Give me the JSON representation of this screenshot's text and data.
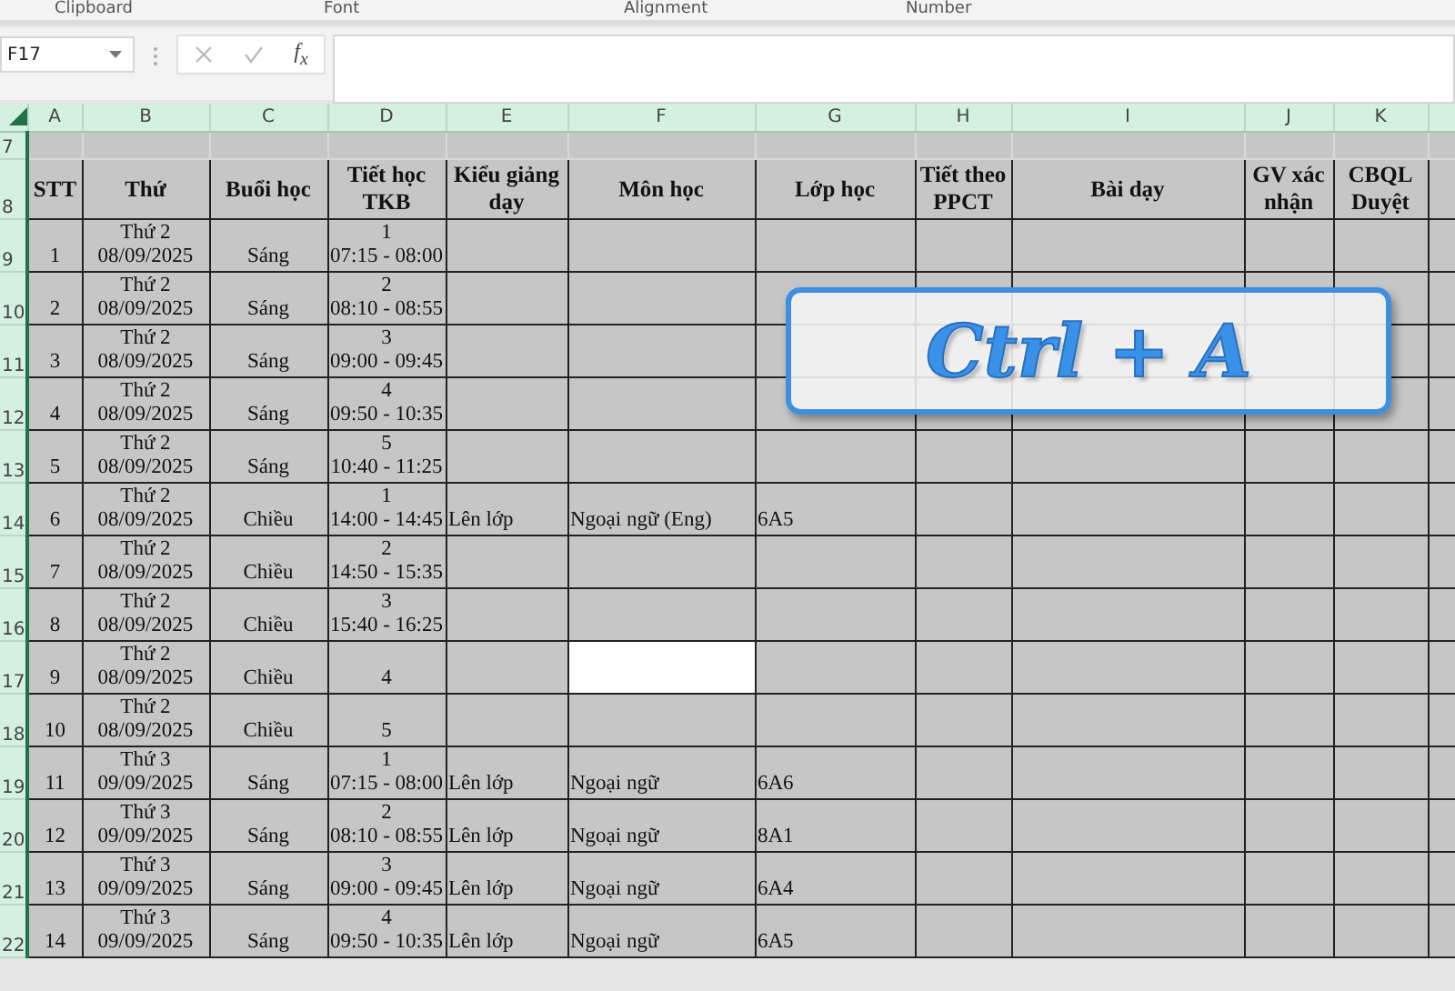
{
  "ribbon_groups": [
    "Clipboard",
    "Font",
    "Alignment",
    "Number"
  ],
  "formula_bar": {
    "name_box": "F17",
    "function_label": "f$_{x}$"
  },
  "columns": [
    "A",
    "B",
    "C",
    "D",
    "E",
    "F",
    "G",
    "H",
    "I",
    "J",
    "K"
  ],
  "blank_row": "7",
  "header_row": {
    "row": "8",
    "cells": [
      "STT",
      "Thứ",
      "Buổi học",
      "Tiết học TKB",
      "Kiểu giảng dạy",
      "Môn học",
      "Lớp học",
      "Tiết theo PPCT",
      "Bài dạy",
      "GV xác nhận",
      "CBQL Duyệt"
    ]
  },
  "rows": [
    {
      "row": "9",
      "stt": "1",
      "thu": "Thứ 2",
      "date": "08/09/2025",
      "buoi": "Sáng",
      "tiet": "1",
      "time": "07:15 - 08:00",
      "mon_hoc": {
        "selected": false
      }
    },
    {
      "row": "10",
      "stt": "2",
      "thu": "Thứ 2",
      "date": "08/09/2025",
      "buoi": "Sáng",
      "tiet": "2",
      "time": "08:10 - 08:55",
      "mon_hoc": {
        "selected": false
      }
    },
    {
      "row": "11",
      "stt": "3",
      "thu": "Thứ 2",
      "date": "08/09/2025",
      "buoi": "Sáng",
      "tiet": "3",
      "time": "09:00 - 09:45",
      "mon_hoc": {
        "selected": false
      }
    },
    {
      "row": "12",
      "stt": "4",
      "thu": "Thứ 2",
      "date": "08/09/2025",
      "buoi": "Sáng",
      "tiet": "4",
      "time": "09:50 - 10:35",
      "mon_hoc": {
        "selected": false
      }
    },
    {
      "row": "13",
      "stt": "5",
      "thu": "Thứ 2",
      "date": "08/09/2025",
      "buoi": "Sáng",
      "tiet": "5",
      "time": "10:40 - 11:25",
      "mon_hoc": {
        "selected": false
      }
    },
    {
      "row": "14",
      "stt": "6",
      "thu": "Thứ 2",
      "date": "08/09/2025",
      "buoi": "Chiều",
      "tiet": "1",
      "time": "14:00 - 14:45",
      "kieu": "Lên lớp",
      "mon_hoc": {
        "text": "Ngoại ngữ (Eng)",
        "selected": false
      },
      "lop": "6A5"
    },
    {
      "row": "15",
      "stt": "7",
      "thu": "Thứ 2",
      "date": "08/09/2025",
      "buoi": "Chiều",
      "tiet": "2",
      "time": "14:50 - 15:35",
      "mon_hoc": {
        "selected": false
      }
    },
    {
      "row": "16",
      "stt": "8",
      "thu": "Thứ 2",
      "date": "08/09/2025",
      "buoi": "Chiều",
      "tiet": "3",
      "time": "15:40 - 16:25",
      "mon_hoc": {
        "selected": false
      }
    },
    {
      "row": "17",
      "stt": "9",
      "thu": "Thứ 2",
      "date": "08/09/2025",
      "buoi": "Chiều",
      "tiet": "4",
      "mon_hoc": {
        "selected": true
      }
    },
    {
      "row": "18",
      "stt": "10",
      "thu": "Thứ 2",
      "date": "08/09/2025",
      "buoi": "Chiều",
      "tiet": "5",
      "mon_hoc": {
        "selected": false
      }
    },
    {
      "row": "19",
      "stt": "11",
      "thu": "Thứ 3",
      "date": "09/09/2025",
      "buoi": "Sáng",
      "tiet": "1",
      "time": "07:15 - 08:00",
      "kieu": "Lên lớp",
      "mon_hoc": {
        "text": "Ngoại ngữ",
        "selected": false
      },
      "lop": "6A6"
    },
    {
      "row": "20",
      "stt": "12",
      "thu": "Thứ 3",
      "date": "09/09/2025",
      "buoi": "Sáng",
      "tiet": "2",
      "time": "08:10 - 08:55",
      "kieu": "Lên lớp",
      "mon_hoc": {
        "text": "Ngoại ngữ",
        "selected": false
      },
      "lop": "8A1"
    },
    {
      "row": "21",
      "stt": "13",
      "thu": "Thứ 3",
      "date": "09/09/2025",
      "buoi": "Sáng",
      "tiet": "3",
      "time": "09:00 - 09:45",
      "kieu": "Lên lớp",
      "mon_hoc": {
        "text": "Ngoại ngữ",
        "selected": false
      },
      "lop": "6A4"
    },
    {
      "row": "22",
      "stt": "14",
      "thu": "Thứ 3",
      "date": "09/09/2025",
      "buoi": "Sáng",
      "tiet": "4",
      "time": "09:50 - 10:35",
      "kieu": "Lên lớp",
      "mon_hoc": {
        "text": "Ngoại ngữ",
        "selected": false
      },
      "lop": "6A5"
    }
  ],
  "callout": "Ctrl + A"
}
